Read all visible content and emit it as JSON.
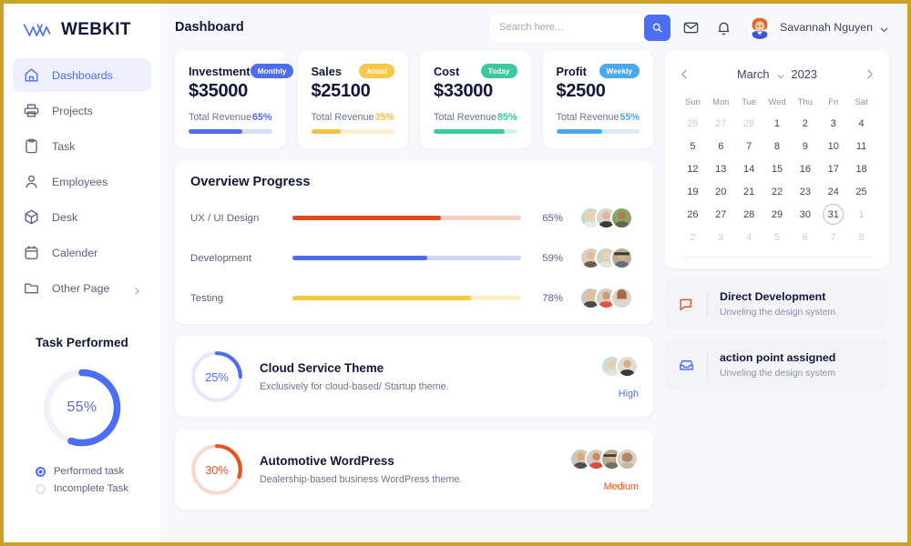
{
  "brand": {
    "name": "WEBKIT",
    "accent": "#4c6ef5"
  },
  "sidebar": {
    "items": [
      {
        "label": "Dashboards",
        "icon": "home-icon",
        "active": true
      },
      {
        "label": "Projects",
        "icon": "printer-icon",
        "active": false
      },
      {
        "label": "Task",
        "icon": "clipboard-icon",
        "active": false
      },
      {
        "label": "Employees",
        "icon": "user-icon",
        "active": false
      },
      {
        "label": "Desk",
        "icon": "box-icon",
        "active": false
      },
      {
        "label": "Calender",
        "icon": "calendar-icon",
        "active": false
      },
      {
        "label": "Other Page",
        "icon": "folder-icon",
        "active": false,
        "chevron": true
      }
    ],
    "task_panel": {
      "title": "Task Performed",
      "percent_label": "55%",
      "percent": 55,
      "legend": [
        {
          "label": "Performed task",
          "selected": true
        },
        {
          "label": "Incomplete Task",
          "selected": false
        }
      ]
    }
  },
  "header": {
    "title": "Dashboard",
    "search_placeholder": "Search here...",
    "search_value": "",
    "user_name": "Savannah Nguyen",
    "icons": [
      "search-icon",
      "mail-icon",
      "bell-icon",
      "chevron-down-icon"
    ]
  },
  "stats": [
    {
      "name": "Investment",
      "badge": "Monthly",
      "badge_color": "#4c6ef5",
      "value": "$35000",
      "sub_label": "Total Revenue",
      "percent_label": "65%",
      "percent": 65,
      "bar_color": "#4c6ef5",
      "track_color": "#d6def9"
    },
    {
      "name": "Sales",
      "badge": "Anual",
      "badge_color": "#fbc748",
      "value": "$25100",
      "sub_label": "Total Revenue",
      "percent_label": "35%",
      "percent": 35,
      "bar_color": "#f5c142",
      "track_color": "#fbeccb"
    },
    {
      "name": "Cost",
      "badge": "Today",
      "badge_color": "#3bc99f",
      "value": "$33000",
      "sub_label": "Total Revenue",
      "percent_label": "85%",
      "percent": 85,
      "bar_color": "#3bc99f",
      "track_color": "#d4f1e7"
    },
    {
      "name": "Profit",
      "badge": "Weekly",
      "badge_color": "#4aa8f0",
      "value": "$2500",
      "sub_label": "Total Revenue",
      "percent_label": "55%",
      "percent": 55,
      "bar_color": "#4aa8f0",
      "track_color": "#d6ecfb"
    }
  ],
  "overview": {
    "title": "Overview Progress",
    "rows": [
      {
        "label": "UX / UI Design",
        "percent_label": "65%",
        "percent": 65,
        "color": "#e0491f",
        "track": "#f7cfc3"
      },
      {
        "label": "Development",
        "percent_label": "59%",
        "percent": 59,
        "color": "#4c6ef5",
        "track": "#ccd7f8"
      },
      {
        "label": "Testing",
        "percent_label": "78%",
        "percent": 78,
        "color": "#f5c93f",
        "track": "#fbeec4"
      }
    ]
  },
  "themes": [
    {
      "name": "Cloud Service Theme",
      "desc": "Exclusively for cloud-based/ Startup theme.",
      "percent_label": "25%",
      "percent": 25,
      "color": "#4c6ef5",
      "track": "#e4e8fa",
      "priority": "High",
      "priority_color": "#4c6ef5",
      "avatars": 2
    },
    {
      "name": "Automotive WordPress",
      "desc": "Dealership-based business WordPress theme.",
      "percent_label": "30%",
      "percent": 30,
      "color": "#e8541f",
      "track": "#f8d9cd",
      "priority": "Medium",
      "priority_color": "#e8541f",
      "avatars": 4
    }
  ],
  "calendar": {
    "month": "March",
    "year": "2023",
    "prev_icon": "chevron-left-icon",
    "next_icon": "chevron-right-icon",
    "dropdown_icon": "chevron-down-icon",
    "dow": [
      "Sun",
      "Mon",
      "Tue",
      "Wed",
      "Thu",
      "Fri",
      "Sat"
    ],
    "selected_day": 31,
    "days": [
      {
        "n": "26",
        "mute": true
      },
      {
        "n": "27",
        "mute": true
      },
      {
        "n": "28",
        "mute": true
      },
      {
        "n": "1"
      },
      {
        "n": "2"
      },
      {
        "n": "3"
      },
      {
        "n": "4"
      },
      {
        "n": "5"
      },
      {
        "n": "6"
      },
      {
        "n": "7"
      },
      {
        "n": "8"
      },
      {
        "n": "9"
      },
      {
        "n": "10"
      },
      {
        "n": "11"
      },
      {
        "n": "12"
      },
      {
        "n": "13"
      },
      {
        "n": "14"
      },
      {
        "n": "15"
      },
      {
        "n": "16"
      },
      {
        "n": "17"
      },
      {
        "n": "18"
      },
      {
        "n": "19"
      },
      {
        "n": "20"
      },
      {
        "n": "21"
      },
      {
        "n": "22"
      },
      {
        "n": "23"
      },
      {
        "n": "24"
      },
      {
        "n": "25"
      },
      {
        "n": "26"
      },
      {
        "n": "27"
      },
      {
        "n": "28"
      },
      {
        "n": "29"
      },
      {
        "n": "30"
      },
      {
        "n": "31",
        "selected": true
      },
      {
        "n": "1",
        "mute": true
      },
      {
        "n": "2",
        "mute": true
      },
      {
        "n": "3",
        "mute": true
      },
      {
        "n": "4",
        "mute": true
      },
      {
        "n": "5",
        "mute": true
      },
      {
        "n": "6",
        "mute": true
      },
      {
        "n": "7",
        "mute": true
      },
      {
        "n": "8",
        "mute": true
      }
    ]
  },
  "notes": [
    {
      "title": "Direct Development",
      "sub": "Unveling the design system",
      "icon": "chat-icon",
      "icon_color": "#e8541f"
    },
    {
      "title": "action point assigned",
      "sub": "Unveling the design system",
      "icon": "inbox-icon",
      "icon_color": "#4c6ef5"
    }
  ]
}
